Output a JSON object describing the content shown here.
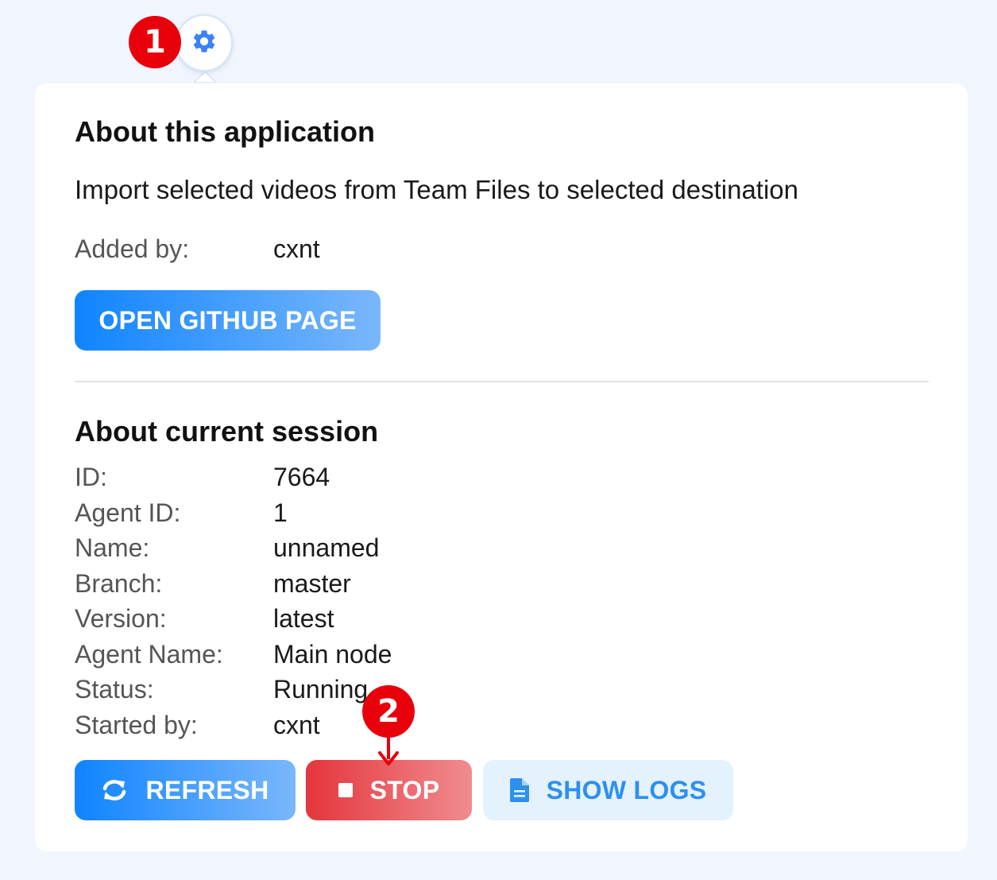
{
  "annotations": {
    "step1": "1",
    "step2": "2"
  },
  "settings_button": {
    "icon": "gear-icon",
    "color": "#3b82f6"
  },
  "about_app": {
    "title": "About this application",
    "description": "Import selected videos from Team Files to selected destination",
    "added_by_label": "Added by:",
    "added_by_value": "cxnt",
    "github_button": "OPEN GITHUB PAGE"
  },
  "about_session": {
    "title": "About current session",
    "rows": [
      {
        "label": "ID:",
        "value": "7664"
      },
      {
        "label": "Agent ID:",
        "value": "1"
      },
      {
        "label": "Name:",
        "value": "unnamed"
      },
      {
        "label": "Branch:",
        "value": "master"
      },
      {
        "label": "Version:",
        "value": "latest"
      },
      {
        "label": "Agent Name:",
        "value": "Main node"
      },
      {
        "label": "Status:",
        "value": "Running"
      },
      {
        "label": "Started by:",
        "value": "cxnt"
      }
    ]
  },
  "actions": {
    "refresh": {
      "label": "REFRESH",
      "icon": "refresh-icon"
    },
    "stop": {
      "label": "STOP",
      "icon": "stop-icon"
    },
    "logs": {
      "label": "SHOW LOGS",
      "icon": "document-icon"
    }
  },
  "colors": {
    "background": "#f1f5fd",
    "primary": "#0f84ff",
    "danger": "#e4353c",
    "annotation": "#e8000b"
  }
}
